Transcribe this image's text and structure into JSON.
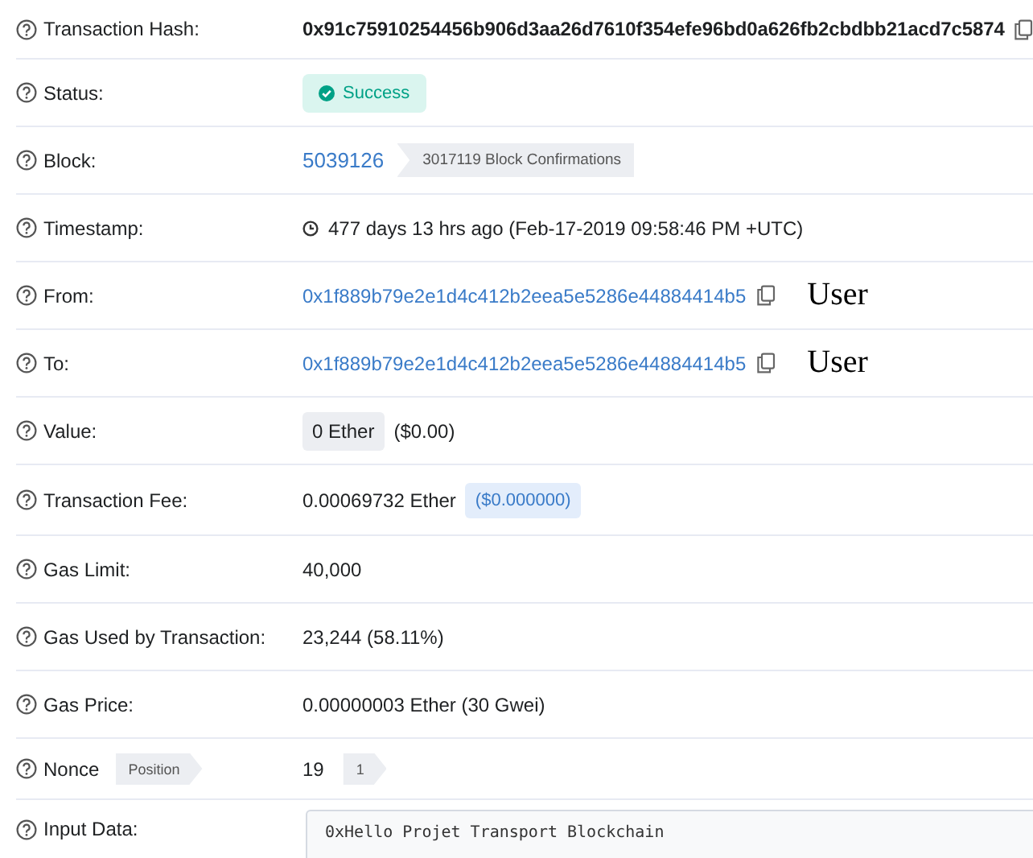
{
  "rows": [
    {
      "label": "Transaction Hash:",
      "kind": "hash",
      "value": "0x91c75910254456b906d3aa26d7610f354efe96bd0a626fb2cbdbb21acd7c5874"
    },
    {
      "label": "Status:",
      "kind": "status",
      "value": "Success"
    },
    {
      "label": "Block:",
      "kind": "block",
      "value": "5039126",
      "badge": "3017119 Block Confirmations"
    },
    {
      "label": "Timestamp:",
      "kind": "time",
      "value": "477 days 13 hrs ago (Feb-17-2019 09:58:46 PM +UTC)"
    },
    {
      "label": "From:",
      "kind": "address",
      "value": "0x1f889b79e2e1d4c412b2eea5e5286e44884414b5",
      "note": "User"
    },
    {
      "label": "To:",
      "kind": "address",
      "value": "0x1f889b79e2e1d4c412b2eea5e5286e44884414b5",
      "note": "User"
    },
    {
      "label": "Value:",
      "kind": "amount",
      "value": "0 Ether",
      "suffix": "($0.00)"
    },
    {
      "label": "Transaction Fee:",
      "kind": "fee",
      "value": "0.00069732 Ether",
      "badge": "($0.000000)"
    },
    {
      "label": "Gas Limit:",
      "kind": "plain",
      "value": "40,000"
    },
    {
      "label": "Gas Used by Transaction:",
      "kind": "plain",
      "value": "23,244 (58.11%)"
    },
    {
      "label": "Gas Price:",
      "kind": "plain",
      "value": "0.00000003 Ether (30 Gwei)"
    },
    {
      "label": "Nonce",
      "label_badge": "Position",
      "kind": "nonce",
      "value": "19",
      "badge": "1"
    },
    {
      "label": "Input Data:",
      "kind": "input",
      "value": "0xHello Projet Transport Blockchain"
    }
  ]
}
